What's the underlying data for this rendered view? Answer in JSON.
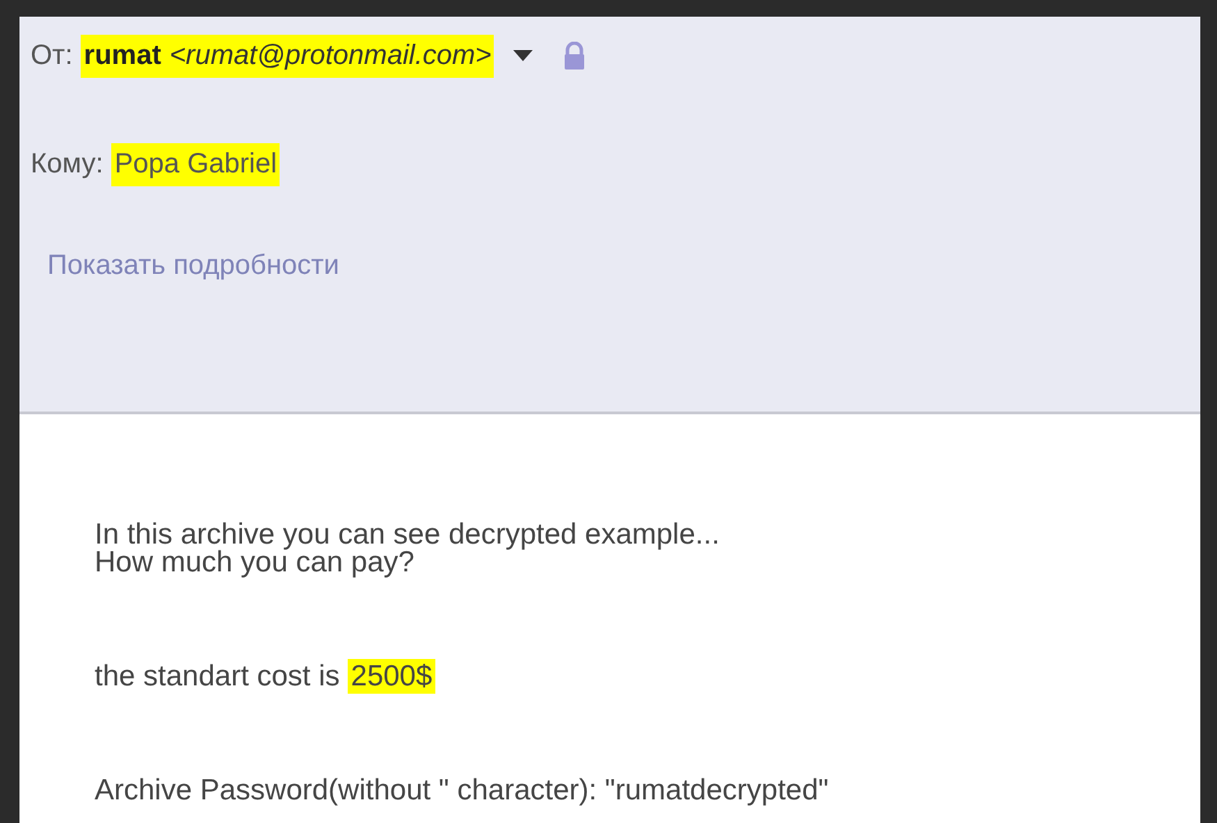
{
  "header": {
    "from": {
      "label": "От:",
      "name": "rumat",
      "email": "<rumat@protonmail.com>",
      "highlighted": true
    },
    "to": {
      "label": "Кому:",
      "name": "Popa Gabriel",
      "highlighted": true
    },
    "details_link": "Показать подробности"
  },
  "body": {
    "paragraphs": [
      {
        "lines": [
          [
            {
              "text": "In this archive you can see decrypted example...",
              "highlighted": false
            }
          ],
          [
            {
              "text": "How much you can pay?",
              "highlighted": false
            }
          ]
        ]
      },
      {
        "lines": [
          [
            {
              "text": "the standart cost is",
              "highlighted": false
            },
            {
              "text": "2500$",
              "highlighted": true
            }
          ]
        ]
      },
      {
        "lines": [
          [
            {
              "text": "Archive Password(without \" character): \"rumatdecrypted\"",
              "highlighted": false
            }
          ]
        ]
      }
    ]
  }
}
